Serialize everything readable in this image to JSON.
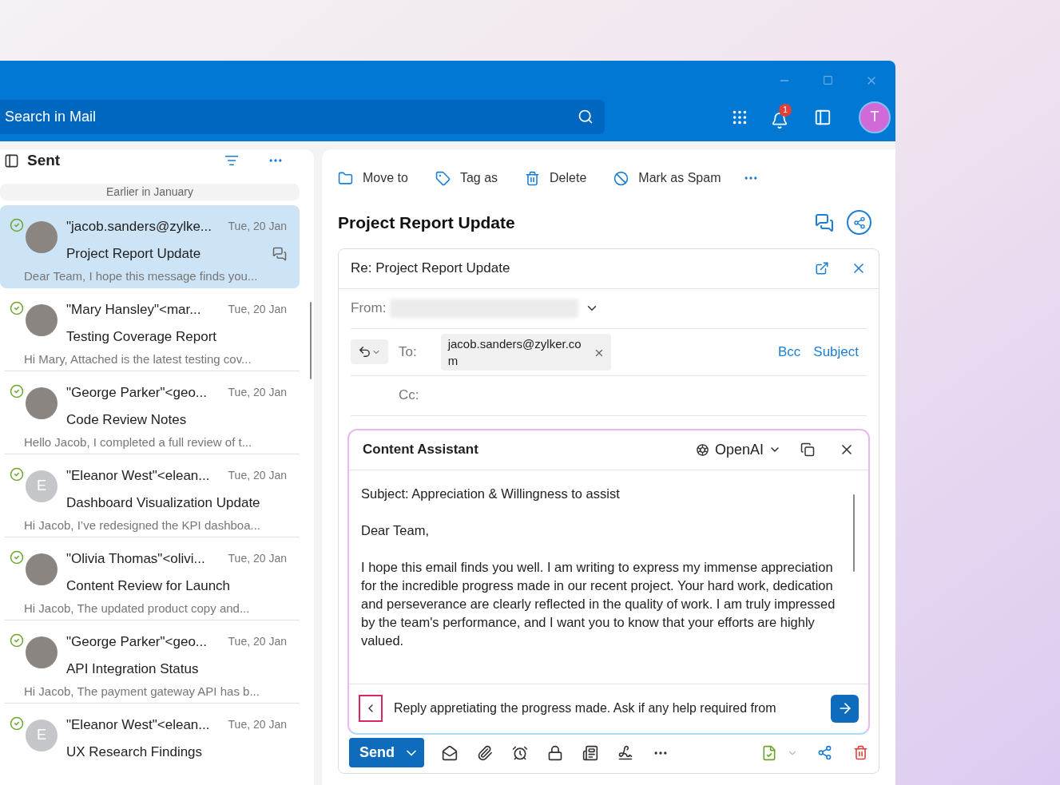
{
  "search": {
    "placeholder": "Search in Mail"
  },
  "header": {
    "notification_count": "1",
    "avatar_initial": "T"
  },
  "folder": {
    "title": "Sent"
  },
  "group_label": "Earlier in January",
  "messages": [
    {
      "sender": "\"jacob.sanders@zylke...",
      "date": "Tue, 20 Jan",
      "subject": "Project Report Update",
      "preview": "Dear Team, I hope this message finds you...",
      "selected": true,
      "thread": true,
      "avatar": {
        "kind": "photo"
      }
    },
    {
      "sender": "\"Mary Hansley\"<mar...",
      "date": "Tue, 20 Jan",
      "subject": "Testing Coverage Report",
      "preview": "Hi Mary, Attached is the latest testing cov...",
      "selected": false,
      "thread": false,
      "avatar": {
        "kind": "photo"
      }
    },
    {
      "sender": "\"George Parker\"<geo...",
      "date": "Tue, 20 Jan",
      "subject": "Code Review Notes",
      "preview": "Hello Jacob, I completed a full review of t...",
      "selected": false,
      "thread": false,
      "avatar": {
        "kind": "photo"
      }
    },
    {
      "sender": "\"Eleanor West\"<elean...",
      "date": "Tue, 20 Jan",
      "subject": "Dashboard Visualization Update",
      "preview": "Hi Jacob, I’ve redesigned the KPI dashboa...",
      "selected": false,
      "thread": false,
      "avatar": {
        "kind": "initial",
        "initial": "E"
      }
    },
    {
      "sender": "\"Olivia Thomas\"<olivi...",
      "date": "Tue, 20 Jan",
      "subject": "Content Review for Launch",
      "preview": "Hi Jacob, The updated product copy and...",
      "selected": false,
      "thread": false,
      "avatar": {
        "kind": "photo"
      }
    },
    {
      "sender": "\"George Parker\"<geo...",
      "date": "Tue, 20 Jan",
      "subject": "API Integration Status",
      "preview": "Hi Jacob, The payment gateway API has b...",
      "selected": false,
      "thread": false,
      "avatar": {
        "kind": "photo"
      }
    },
    {
      "sender": "\"Eleanor West\"<elean...",
      "date": "Tue, 20 Jan",
      "subject": "UX Research Findings",
      "selected": false,
      "thread": false,
      "avatar": {
        "kind": "initial",
        "initial": "E"
      }
    }
  ],
  "actions": [
    {
      "label": "Move to"
    },
    {
      "label": "Tag as"
    },
    {
      "label": "Delete"
    },
    {
      "label": "Mark as Spam"
    }
  ],
  "message_title": "Project Report Update",
  "compose": {
    "title": "Re: Project Report Update",
    "from_label": "From:",
    "to_label": "To:",
    "recipient": "jacob.sanders@zylker.co m",
    "bcc": "Bcc",
    "subject_link": "Subject",
    "cc_label": "Cc:"
  },
  "assistant": {
    "title": "Content Assistant",
    "provider": "OpenAI",
    "body": [
      "Subject: Appreciation & Willingness to assist",
      "Dear Team,",
      "I hope this email finds you well. I am writing to express my immense appreciation for the incredible progress made in our recent project. Your hard work, dedication and perseverance are clearly reflected in the quality of work. I am truly impressed by the team's performance, and I want you to know that your efforts are highly valued."
    ],
    "prompt": "Reply appretiating the progress made. Ask if any help required from"
  },
  "send_label": "Send"
}
